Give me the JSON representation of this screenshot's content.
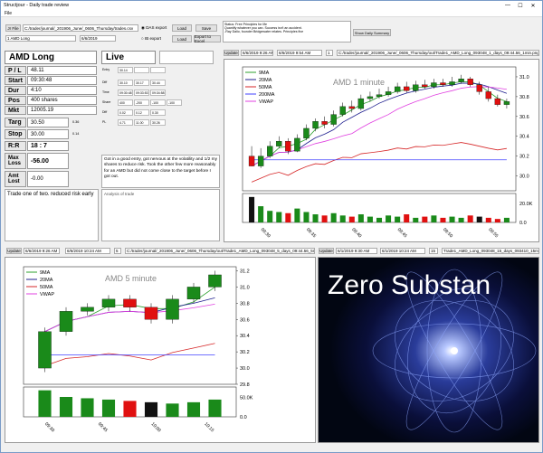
{
  "window": {
    "title": "Structjour - Daily trade review",
    "minimize": "—",
    "maximize": "☐",
    "close": "✕"
  },
  "menu": {
    "file": "File"
  },
  "file": {
    "button": "Jr File",
    "path": "C:/trader/journal/_201906_June/_0606_Thursday/trades.csv",
    "das_label": "DAS export",
    "ib_label": "IB export",
    "load_label": "Load",
    "save_label": "Save",
    "export_label": "Export to Excel",
    "ib_date": "1/1/2019",
    "load_name": "Load"
  },
  "trade_select": {
    "value": "1 AMD Long",
    "date": "6/6/2019"
  },
  "summary": {
    "text": "Daily Summary button",
    "button": "Show Daily Summary",
    "note1": "Status: Free Principles for life",
    "note2": "Quantify whatever you can. Success isn't an accident.",
    "note3": "-Ray Dalio, founder Bridgewater relates. Principles five"
  },
  "trade": {
    "title": "AMD Long",
    "status": "Live"
  },
  "stats": [
    {
      "label": "P / L",
      "value": "48.11"
    },
    {
      "label": "Start",
      "value": "09:30:48"
    },
    {
      "label": "Dur",
      "value": "4:10"
    },
    {
      "label": "Pos",
      "value": "400 shares"
    },
    {
      "label": "Mkt",
      "value": "12005.19"
    }
  ],
  "targ": {
    "label": "Targ",
    "value": "30.50",
    "diff": "0.36"
  },
  "stop": {
    "label": "Stop",
    "value": "30.00",
    "diff": "0.14"
  },
  "rr": {
    "label": "R:R",
    "value": "18 : 7"
  },
  "maxloss": {
    "label": "Max Loss",
    "value": "-56.00"
  },
  "amtlost": {
    "label": "Amt Lost",
    "value": "-0.00"
  },
  "tx": {
    "rowlabels": [
      "Entry",
      "Diff",
      "Time",
      "Share",
      "Diff",
      "PL"
    ],
    "r0": [
      "30.14",
      "",
      ""
    ],
    "r1": [
      "30.10",
      "30.17",
      "30.44"
    ],
    "r2": [
      "09:30:48",
      "09:33:53",
      "09:34:58"
    ],
    "r3": [
      "400",
      "-200",
      "-100",
      "-100"
    ],
    "r4": [
      "0.02",
      "0.12",
      "0.30"
    ],
    "r5": [
      "4.71",
      "11.00",
      "30.26"
    ]
  },
  "notes": {
    "text": "Got in a good entry, got nervous at the volatility and 1/2 my shares to reduce risk. Took the other few more reasonably for an AMD but did not come close to the target before I got out.",
    "strategy": "Trade one of two. reduced risk early",
    "analysis": "Analysis of trade"
  },
  "img1": {
    "update": "Update",
    "start": "6/6/2019 9:26 AM",
    "end": "6/6/2019 9:54 AM",
    "interval": "1",
    "path": "C:/trader/journal/_201906_June/_0606_Thursday/out/Trade1_AMD_Long_093048_1_days_09:44.56_1min.png"
  },
  "img2": {
    "update": "Update",
    "start": "6/6/2019 9:26 AM",
    "end": "6/6/2019 10:24 AM",
    "interval": "5",
    "path": "C:/trader/journal/_201906_June/_0606_Thursday/out/Trade1_AMD_Long_093048_5_days_09:44.56_5min.png"
  },
  "img3": {
    "update": "Update",
    "start": "6/1/2019 9:30 AM",
    "end": "6/1/2019 10:24 AM",
    "interval": "15",
    "path": "Trade1_AMD_Long_093048_15_days_093410_15min.png"
  },
  "zero": {
    "text": "Zero Substan"
  },
  "chart_data": [
    {
      "type": "bar",
      "title": "AMD 1 minute",
      "series": [
        {
          "name": "9MA"
        },
        {
          "name": "20MA"
        },
        {
          "name": "50MA"
        },
        {
          "name": "200MA"
        },
        {
          "name": "VWAP"
        }
      ],
      "yticks": [
        "31.0",
        "30.8",
        "30.6",
        "30.4",
        "30.2",
        "30.0"
      ],
      "vticks": [
        "20.0K",
        "0.0"
      ],
      "xticks": [
        "09:30",
        "09:35",
        "09:40",
        "09:45",
        "09:50",
        "09:55"
      ],
      "colors": {
        "9MA": "#2ca02c",
        "20MA": "#1f1f8f",
        "50MA": "#d62728",
        "200MA": "#4040ff",
        "VWAP": "#e040e0",
        "up": "#1a8a1a",
        "down": "#e01010"
      },
      "candles": [
        [
          30.2,
          30.1,
          30.3,
          30.1
        ],
        [
          30.1,
          30.2,
          30.28,
          30.08
        ],
        [
          30.2,
          30.3,
          30.35,
          30.18
        ],
        [
          30.3,
          30.35,
          30.4,
          30.28
        ],
        [
          30.35,
          30.25,
          30.38,
          30.22
        ],
        [
          30.25,
          30.38,
          30.42,
          30.24
        ],
        [
          30.38,
          30.48,
          30.52,
          30.36
        ],
        [
          30.48,
          30.55,
          30.58,
          30.45
        ],
        [
          30.55,
          30.52,
          30.6,
          30.48
        ],
        [
          30.52,
          30.62,
          30.66,
          30.5
        ],
        [
          30.62,
          30.7,
          30.74,
          30.6
        ],
        [
          30.7,
          30.68,
          30.76,
          30.64
        ],
        [
          30.68,
          30.78,
          30.82,
          30.66
        ],
        [
          30.78,
          30.8,
          30.85,
          30.75
        ],
        [
          30.8,
          30.82,
          30.88,
          30.78
        ],
        [
          30.82,
          30.85,
          30.9,
          30.8
        ],
        [
          30.85,
          30.9,
          30.94,
          30.83
        ],
        [
          30.9,
          30.86,
          30.95,
          30.84
        ],
        [
          30.86,
          30.92,
          30.96,
          30.84
        ],
        [
          30.92,
          30.9,
          30.97,
          30.88
        ],
        [
          30.9,
          30.94,
          30.98,
          30.88
        ],
        [
          30.94,
          30.92,
          30.98,
          30.9
        ],
        [
          30.92,
          30.95,
          31.0,
          30.9
        ],
        [
          30.95,
          30.98,
          31.02,
          30.93
        ],
        [
          30.98,
          30.92,
          31.0,
          30.9
        ],
        [
          30.92,
          30.85,
          30.95,
          30.82
        ],
        [
          30.85,
          30.78,
          30.9,
          30.75
        ],
        [
          30.78,
          30.72,
          30.82,
          30.7
        ],
        [
          30.72,
          30.75,
          30.78,
          30.68
        ]
      ],
      "volume": [
        22,
        14,
        10,
        9,
        8,
        12,
        9,
        7,
        6,
        8,
        6,
        5,
        7,
        5,
        4,
        6,
        5,
        7,
        4,
        5,
        6,
        4,
        5,
        4,
        6,
        5,
        4,
        3,
        4
      ]
    },
    {
      "type": "bar",
      "title": "AMD 5 minute",
      "series": [
        {
          "name": "9MA"
        },
        {
          "name": "20MA"
        },
        {
          "name": "50MA"
        },
        {
          "name": "VWAP"
        }
      ],
      "yticks": [
        "31.2",
        "31.0",
        "30.8",
        "30.6",
        "30.4",
        "30.2",
        "30.0",
        "29.8"
      ],
      "vticks": [
        "50.0K",
        "0.0"
      ],
      "xticks": [
        "09:30",
        "09:45",
        "10:00",
        "10:15"
      ],
      "candles": [
        [
          30.0,
          30.45,
          30.5,
          29.95
        ],
        [
          30.45,
          30.7,
          30.75,
          30.4
        ],
        [
          30.7,
          30.75,
          30.8,
          30.65
        ],
        [
          30.75,
          30.85,
          30.9,
          30.7
        ],
        [
          30.85,
          30.75,
          30.9,
          30.7
        ],
        [
          30.75,
          30.6,
          30.8,
          30.55
        ],
        [
          30.6,
          30.85,
          30.9,
          30.55
        ],
        [
          30.85,
          31.0,
          31.05,
          30.8
        ],
        [
          31.0,
          31.15,
          31.2,
          30.95
        ]
      ],
      "volume": [
        40,
        30,
        28,
        26,
        24,
        22,
        20,
        22,
        26
      ]
    }
  ]
}
